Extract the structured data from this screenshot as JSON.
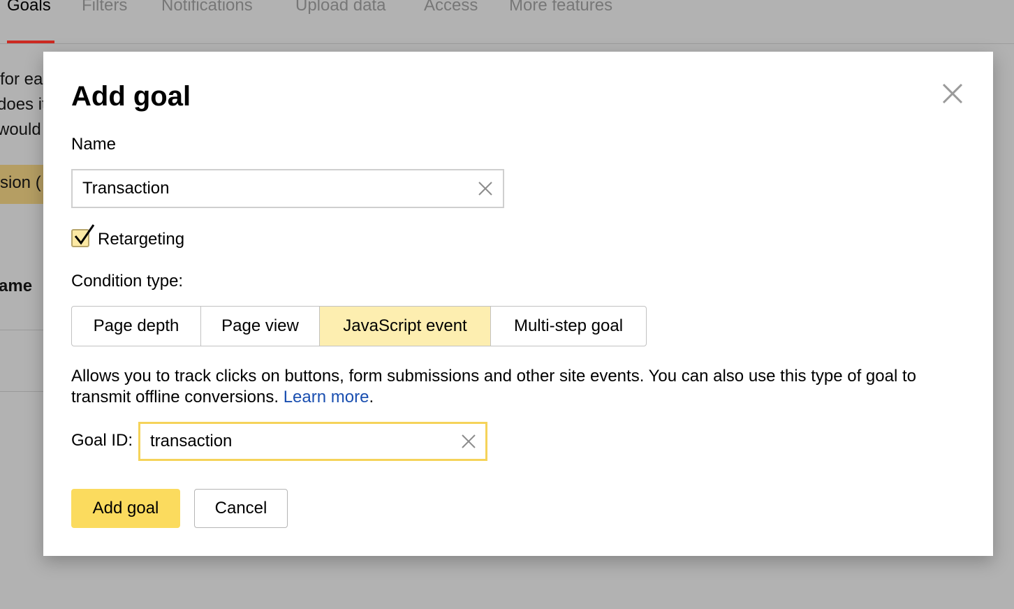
{
  "background": {
    "tabs": [
      {
        "label": "Goals",
        "active": true
      },
      {
        "label": "Filters",
        "active": false
      },
      {
        "label": "Notifications",
        "active": false
      },
      {
        "label": "Upload data",
        "active": false
      },
      {
        "label": "Access",
        "active": false
      },
      {
        "label": "More features",
        "active": false
      }
    ],
    "text_fragments": [
      "for ea",
      "does it",
      "would",
      "sion (",
      "ame"
    ]
  },
  "modal": {
    "title": "Add goal",
    "name_label": "Name",
    "name_value": "Transaction",
    "retargeting_label": "Retargeting",
    "retargeting_checked": true,
    "condition_label": "Condition type:",
    "condition_types": [
      {
        "label": "Page depth",
        "active": false
      },
      {
        "label": "Page view",
        "active": false
      },
      {
        "label": "JavaScript event",
        "active": true
      },
      {
        "label": "Multi-step goal",
        "active": false
      }
    ],
    "description": "Allows you to track clicks on buttons, form submissions and other site events. You can also use this type of goal to transmit offline conversions.",
    "learn_more": "Learn more",
    "goal_id_label": "Goal ID:",
    "goal_id_value": "transaction",
    "add_button": "Add goal",
    "cancel_button": "Cancel"
  },
  "colors": {
    "accent_yellow": "#fbdb5e",
    "active_segment": "#fdeeb0",
    "focus_border": "#f5d35a",
    "link": "#1a4fb0",
    "tab_underline": "#cc2a22"
  },
  "icons": {
    "close": "close-icon",
    "clear": "clear-input-icon",
    "check": "checkmark-icon"
  }
}
